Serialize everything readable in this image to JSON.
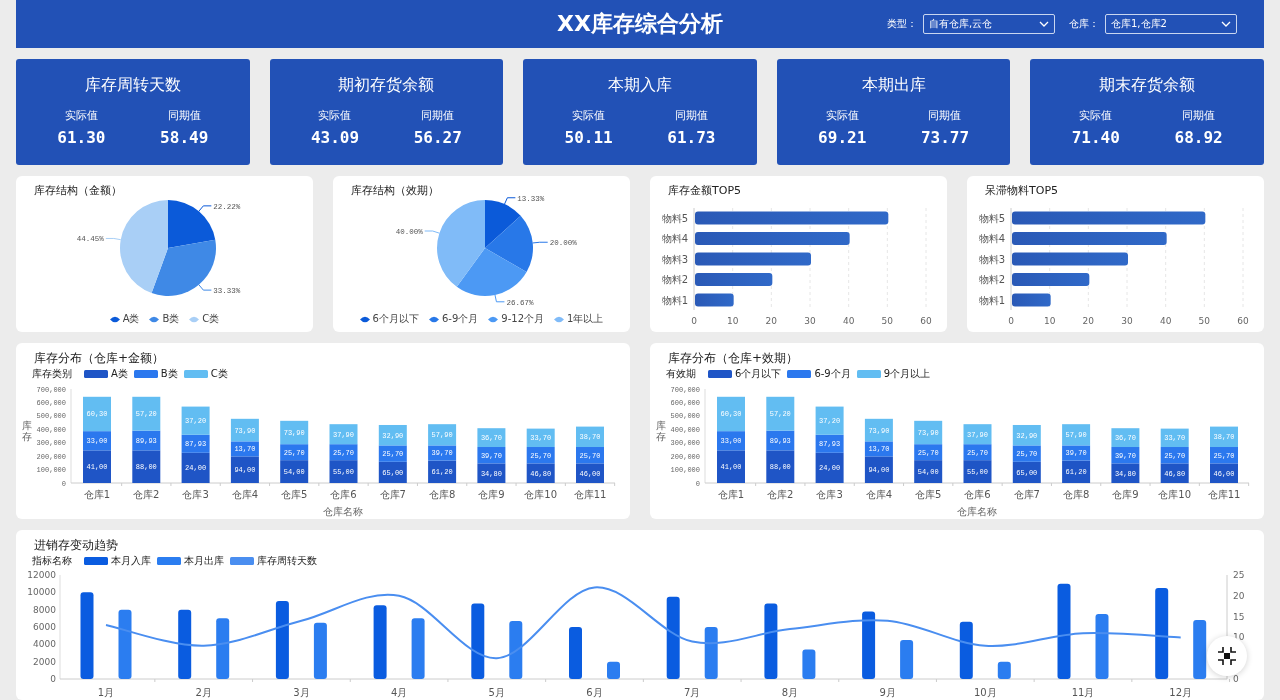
{
  "header": {
    "title": "XX库存综合分析",
    "filters": [
      {
        "label": "类型：",
        "value": "自有仓库,云仓"
      },
      {
        "label": "仓库：",
        "value": "仓库1,仓库2"
      }
    ]
  },
  "kpis": [
    {
      "title": "库存周转天数",
      "actual_label": "实际值",
      "actual": "61.30",
      "prior_label": "同期值",
      "prior": "58.49"
    },
    {
      "title": "期初存货余额",
      "actual_label": "实际值",
      "actual": "43.09",
      "prior_label": "同期值",
      "prior": "56.27"
    },
    {
      "title": "本期入库",
      "actual_label": "实际值",
      "actual": "50.11",
      "prior_label": "同期值",
      "prior": "61.73"
    },
    {
      "title": "本期出库",
      "actual_label": "实际值",
      "actual": "69.21",
      "prior_label": "同期值",
      "prior": "73.77"
    },
    {
      "title": "期末存货余额",
      "actual_label": "实际值",
      "actual": "71.40",
      "prior_label": "同期值",
      "prior": "68.92"
    }
  ],
  "top_charts": [
    {
      "title": "库存结构（金额）",
      "chart_data": {
        "type": "pie",
        "categories": [
          "A类",
          "B类",
          "C类"
        ],
        "values": [
          22.22,
          33.33,
          44.45
        ],
        "colors": [
          "#0b5ad9",
          "#3f89e6",
          "#a9cff6"
        ],
        "value_labels": [
          "22.22%",
          "33.33%",
          "44.45%"
        ],
        "legend": true
      }
    },
    {
      "title": "库存结构（效期）",
      "chart_data": {
        "type": "pie",
        "categories": [
          "6个月以下",
          "6-9个月",
          "9-12个月",
          "1年以上"
        ],
        "values": [
          13.33,
          20,
          26.67,
          40
        ],
        "colors": [
          "#0b5ad9",
          "#2878e8",
          "#4c99f4",
          "#80bbf8"
        ],
        "value_labels": [
          "13.33%",
          "20.00%",
          "26.67%",
          "40.00%"
        ],
        "legend": true
      }
    },
    {
      "title": "库存金额TOP5",
      "chart_data": {
        "type": "bar",
        "orientation": "horizontal",
        "grid": true,
        "categories": [
          "物料5",
          "物料4",
          "物料3",
          "物料2",
          "物料1"
        ],
        "values": [
          50,
          40,
          30,
          20,
          10
        ],
        "xlim": [
          0,
          60
        ],
        "xticks": [
          0,
          10,
          20,
          30,
          40,
          50,
          60
        ]
      }
    },
    {
      "title": "呆滞物料TOP5",
      "chart_data": {
        "type": "bar",
        "orientation": "horizontal",
        "grid": true,
        "categories": [
          "物料5",
          "物料4",
          "物料3",
          "物料2",
          "物料1"
        ],
        "values": [
          50,
          40,
          30,
          20,
          10
        ],
        "xlim": [
          0,
          60
        ],
        "xticks": [
          0,
          10,
          20,
          30,
          40,
          50,
          60
        ]
      }
    }
  ],
  "distribution_charts": [
    {
      "title": "库存分布（仓库+金额）",
      "chart_data": {
        "type": "bar",
        "stacked": true,
        "legend": {
          "title": "库存类别"
        },
        "xlabel": "仓库名称",
        "ylabel": "库存",
        "categories": [
          "仓库1",
          "仓库2",
          "仓库3",
          "仓库4",
          "仓库5",
          "仓库6",
          "仓库7",
          "仓库8",
          "仓库9",
          "仓库10",
          "仓库11"
        ],
        "ylim": [
          0,
          700000
        ],
        "yticks": [
          {
            "value": 0,
            "label": "0"
          },
          {
            "value": 100000,
            "label": "100,000"
          },
          {
            "value": 200000,
            "label": "200,000"
          },
          {
            "value": 300000,
            "label": "300,000"
          },
          {
            "value": 400000,
            "label": "400,000"
          },
          {
            "value": 500000,
            "label": "500,000"
          },
          {
            "value": 600000,
            "label": "600,000"
          },
          {
            "value": 700000,
            "label": "700,000"
          }
        ],
        "series": [
          {
            "name": "A类",
            "color": "#1f55c6",
            "values": [
              243000,
              243000,
              225000,
              198000,
              170000,
              170000,
              158000,
              167000,
              146000,
              146000,
              146000
            ]
          },
          {
            "name": "B类",
            "color": "#2b78ee",
            "values": [
              143000,
              147000,
              134000,
              112000,
              119000,
              119000,
              122000,
              113000,
              122000,
              122000,
              122000
            ]
          },
          {
            "name": "C类",
            "color": "#62bdf2",
            "values": [
              256000,
              252000,
              210000,
              168000,
              174000,
              149000,
              152000,
              158000,
              140000,
              137000,
              152000
            ]
          }
        ],
        "annotations": [
          "41,00",
          "88,00",
          "24,00",
          "94,00",
          "54,00",
          "55,00",
          "65,00",
          "61,20",
          "34,80",
          "46,80",
          "46,00",
          "33,00",
          "89,93",
          "87,93",
          "13,70",
          "25,70",
          "25,70",
          "25,70",
          "39,70",
          "39,70",
          "25,70",
          "25,70",
          "60,30",
          "57,20",
          "37,20",
          "73,90",
          "73,90",
          "37,90",
          "32,90",
          "57,90",
          "36,70",
          "33,70",
          "38,70"
        ]
      }
    },
    {
      "title": "库存分布（仓库+效期）",
      "chart_data": {
        "type": "bar",
        "stacked": true,
        "legend": {
          "title": "有效期"
        },
        "xlabel": "仓库名称",
        "ylabel": "库存",
        "categories": [
          "仓库1",
          "仓库2",
          "仓库3",
          "仓库4",
          "仓库5",
          "仓库6",
          "仓库7",
          "仓库8",
          "仓库9",
          "仓库10",
          "仓库11"
        ],
        "ylim": [
          0,
          700000
        ],
        "yticks": [
          {
            "value": 0,
            "label": "0"
          },
          {
            "value": 100000,
            "label": "100,000"
          },
          {
            "value": 200000,
            "label": "200,000"
          },
          {
            "value": 300000,
            "label": "300,000"
          },
          {
            "value": 400000,
            "label": "400,000"
          },
          {
            "value": 500000,
            "label": "500,000"
          },
          {
            "value": 600000,
            "label": "600,000"
          },
          {
            "value": 700000,
            "label": "700,000"
          }
        ],
        "series": [
          {
            "name": "6个月以下",
            "color": "#1f55c6",
            "values": [
              243000,
              243000,
              225000,
              198000,
              170000,
              170000,
              158000,
              167000,
              146000,
              146000,
              146000
            ]
          },
          {
            "name": "6-9个月",
            "color": "#2b78ee",
            "values": [
              143000,
              147000,
              134000,
              112000,
              119000,
              119000,
              122000,
              113000,
              122000,
              122000,
              122000
            ]
          },
          {
            "name": "9个月以上",
            "color": "#62bdf2",
            "values": [
              256000,
              252000,
              210000,
              168000,
              174000,
              149000,
              152000,
              158000,
              140000,
              137000,
              152000
            ]
          }
        ],
        "annotations": [
          "41,00",
          "88,00",
          "24,00",
          "94,00",
          "54,00",
          "55,00",
          "65,00",
          "61,20",
          "34,80",
          "46,80",
          "46,00",
          "33,00",
          "89,93",
          "87,93",
          "13,70",
          "25,70",
          "25,70",
          "25,70",
          "39,70",
          "39,70",
          "25,70",
          "25,70",
          "60,30",
          "57,20",
          "37,20",
          "73,90",
          "73,90",
          "37,90",
          "32,90",
          "57,90",
          "36,70",
          "33,70",
          "38,70"
        ]
      }
    }
  ],
  "trend_chart": {
    "title": "进销存变动趋势",
    "chart_data": {
      "type": "bar",
      "legend": {
        "title": "指标名称"
      },
      "categories": [
        "1月",
        "2月",
        "3月",
        "4月",
        "5月",
        "6月",
        "7月",
        "8月",
        "9月",
        "10月",
        "11月",
        "12月"
      ],
      "ylim": [
        0,
        12000
      ],
      "yticks": [
        0,
        2000,
        4000,
        6000,
        8000,
        10000,
        12000
      ],
      "y2lim": [
        0,
        25
      ],
      "y2ticks": [
        0,
        10,
        15,
        20,
        25
      ],
      "series": [
        {
          "name": "本月入库",
          "type": "bar",
          "color": "#0a5ce0",
          "values": [
            10000,
            8000,
            9000,
            8500,
            8700,
            6000,
            9500,
            8700,
            7800,
            6600,
            11000,
            10500
          ]
        },
        {
          "name": "本月出库",
          "type": "bar",
          "color": "#2b7df0",
          "values": [
            8000,
            7000,
            6500,
            7000,
            6700,
            2000,
            6000,
            3400,
            4500,
            2000,
            7500,
            6800
          ]
        },
        {
          "name": "库存周转天数",
          "type": "line",
          "axis": "y2",
          "color": "#4a8ef0",
          "values": [
            13,
            8,
            14,
            20,
            5,
            22,
            9,
            12,
            14,
            8,
            11,
            10
          ]
        }
      ]
    }
  }
}
